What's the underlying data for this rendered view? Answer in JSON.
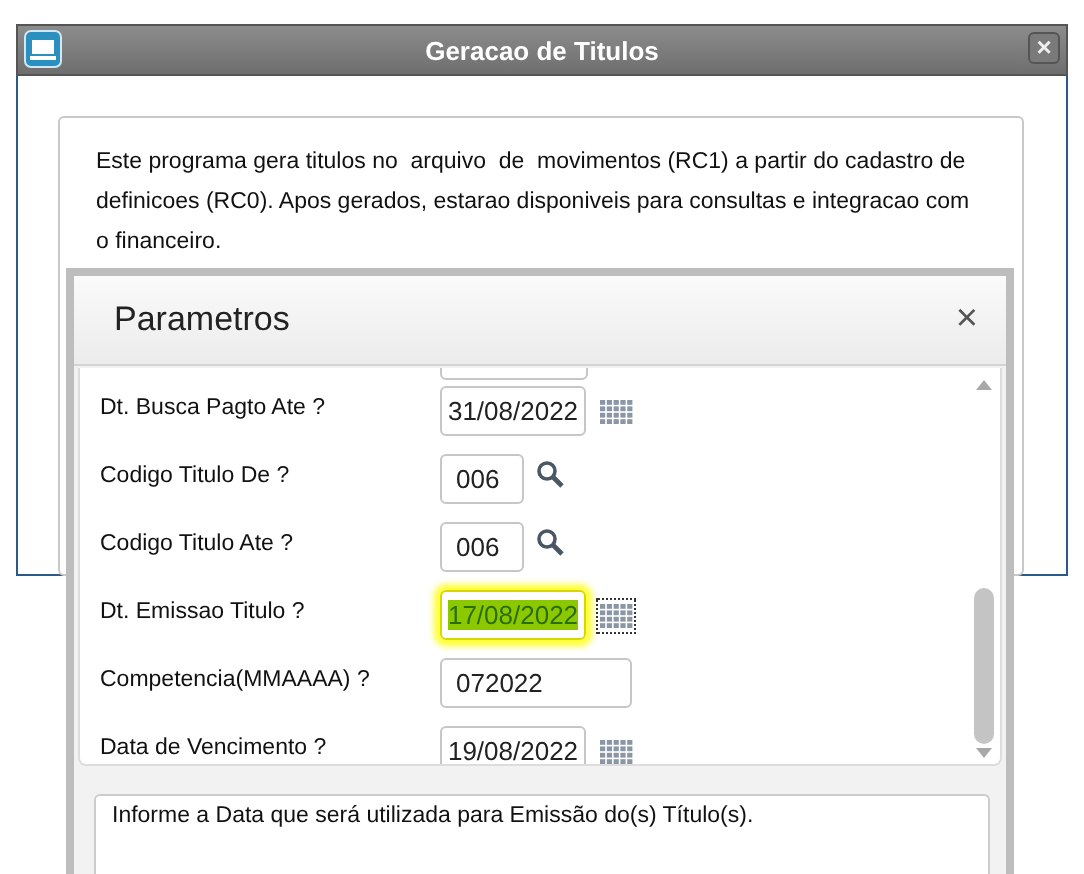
{
  "window": {
    "title": "Geracao de Titulos",
    "close": "×",
    "description": "Este programa gera titulos no  arquivo  de  movimentos (RC1) a partir do cadastro de definicoes (RC0). Apos gerados, estarao disponiveis para consultas e integracao com o financeiro."
  },
  "dialog": {
    "title": "Parametros",
    "close": "×",
    "fields": [
      {
        "label": "Dt. Busca Pagto Ate ?",
        "value": "31/08/2022",
        "kind": "date",
        "highlighted": false
      },
      {
        "label": "Codigo Titulo De ?",
        "value": "006",
        "kind": "lookup",
        "highlighted": false
      },
      {
        "label": "Codigo Titulo Ate ?",
        "value": "006",
        "kind": "lookup",
        "highlighted": false
      },
      {
        "label": "Dt. Emissao Titulo ?",
        "value": "17/08/2022",
        "kind": "date",
        "highlighted": true
      },
      {
        "label": "Competencia(MMAAAA) ?",
        "value": "072022",
        "kind": "text",
        "highlighted": false
      },
      {
        "label": "Data de Vencimento ?",
        "value": "19/08/2022",
        "kind": "date",
        "highlighted": false
      }
    ],
    "help": "Informe a Data que será utilizada para Emissão do(s) Título(s)."
  }
}
